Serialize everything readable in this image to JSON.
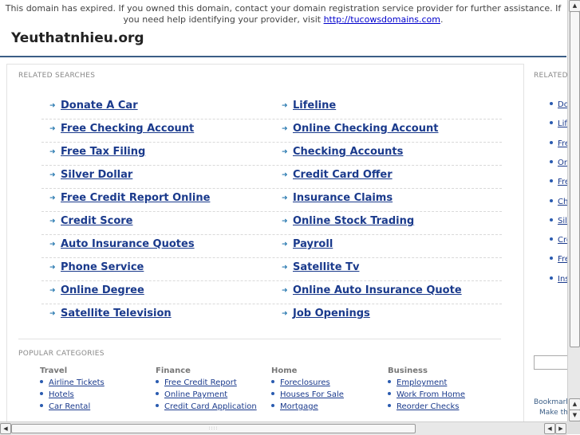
{
  "notice": {
    "text": "This domain has expired. If you owned this domain, contact your domain registration service provider for further assistance. If you need help identifying your provider, visit ",
    "link": "http://tucowsdomains.com",
    "suffix": "."
  },
  "site_title": "Yeuthatnhieu.org",
  "related": {
    "heading": "RELATED SEARCHES",
    "left": [
      "Donate A Car",
      "Free Checking Account",
      "Free Tax Filing",
      "Silver Dollar",
      "Free Credit Report Online",
      "Credit Score",
      "Auto Insurance Quotes",
      "Phone Service",
      "Online Degree",
      "Satellite Television"
    ],
    "right": [
      "Lifeline",
      "Online Checking Account",
      "Checking Accounts",
      "Credit Card Offer",
      "Insurance Claims",
      "Online Stock Trading",
      "Payroll",
      "Satellite Tv",
      "Online Auto Insurance Quote",
      "Job Openings"
    ]
  },
  "popular": {
    "heading": "POPULAR CATEGORIES",
    "columns": [
      {
        "title": "Travel",
        "items": [
          "Airline Tickets",
          "Hotels",
          "Car Rental"
        ]
      },
      {
        "title": "Finance",
        "items": [
          "Free Credit Report",
          "Online Payment",
          "Credit Card Application"
        ]
      },
      {
        "title": "Home",
        "items": [
          "Foreclosures",
          "Houses For Sale",
          "Mortgage"
        ]
      },
      {
        "title": "Business",
        "items": [
          "Employment",
          "Work From Home",
          "Reorder Checks"
        ]
      }
    ]
  },
  "side": {
    "heading": "RELATED",
    "items": [
      "Do",
      "Life",
      "Fre",
      "Onl",
      "Fre",
      "Ch",
      "Silv",
      "Cre",
      "Fre",
      "Ins"
    ],
    "bookmark": "Bookmark",
    "make": "Make this"
  },
  "colors": {
    "accent": "#3b5e86",
    "link": "#1a3a8c",
    "arrow": "#2a7ab0"
  },
  "icons": {
    "arrow": "arrow-right-icon",
    "dot": "bullet-icon"
  }
}
